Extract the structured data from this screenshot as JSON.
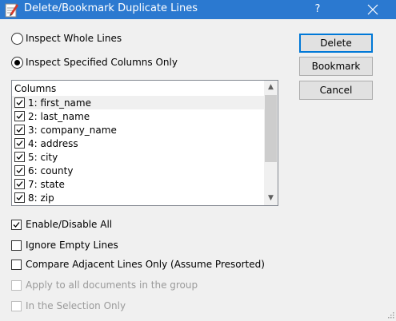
{
  "window": {
    "title": "Delete/Bookmark Duplicate Lines",
    "help_label": "?",
    "icon": "pencil-document-icon",
    "titlebar_color": "#2b79d0"
  },
  "mode": {
    "whole_lines_label": "Inspect Whole Lines",
    "specified_columns_label": "Inspect Specified Columns Only",
    "selected": "specified_columns"
  },
  "buttons": {
    "delete_label": "Delete",
    "bookmark_label": "Bookmark",
    "cancel_label": "Cancel"
  },
  "columns": {
    "header": "Columns",
    "items": [
      {
        "label": "1: first_name",
        "checked": true
      },
      {
        "label": "2: last_name",
        "checked": true
      },
      {
        "label": "3: company_name",
        "checked": true
      },
      {
        "label": "4: address",
        "checked": true
      },
      {
        "label": "5: city",
        "checked": true
      },
      {
        "label": "6: county",
        "checked": true
      },
      {
        "label": "7: state",
        "checked": true
      },
      {
        "label": "8: zip",
        "checked": true
      }
    ]
  },
  "options": {
    "enable_disable_all": {
      "label": "Enable/Disable All",
      "checked": true
    },
    "ignore_empty_lines": {
      "label": "Ignore Empty Lines",
      "checked": false
    },
    "compare_adjacent": {
      "label": "Compare Adjacent Lines Only (Assume Presorted)",
      "checked": false
    },
    "apply_all_documents": {
      "label": "Apply to all documents in the group",
      "checked": false,
      "enabled": false
    },
    "selection_only": {
      "label": "In the Selection Only",
      "checked": false,
      "enabled": false
    }
  }
}
